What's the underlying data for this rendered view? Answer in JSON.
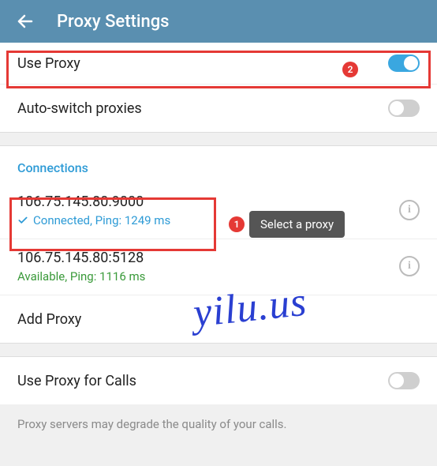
{
  "header": {
    "title": "Proxy Settings"
  },
  "useProxy": {
    "label": "Use Proxy",
    "on": true
  },
  "autoSwitch": {
    "label": "Auto-switch proxies",
    "on": false
  },
  "connections": {
    "header": "Connections",
    "items": [
      {
        "address": "106.75.145.80:9000",
        "status": "Connected, Ping: 1249 ms",
        "state": "connected"
      },
      {
        "address": "106.75.145.80:5128",
        "status": "Available, Ping: 1116 ms",
        "state": "available"
      }
    ],
    "add": "Add Proxy"
  },
  "calls": {
    "label": "Use Proxy for Calls",
    "on": false,
    "note": "Proxy servers may degrade the quality of your calls."
  },
  "annotations": {
    "tooltip": "Select a proxy",
    "badge1": "1",
    "badge2": "2"
  },
  "watermark": "yilu.us"
}
